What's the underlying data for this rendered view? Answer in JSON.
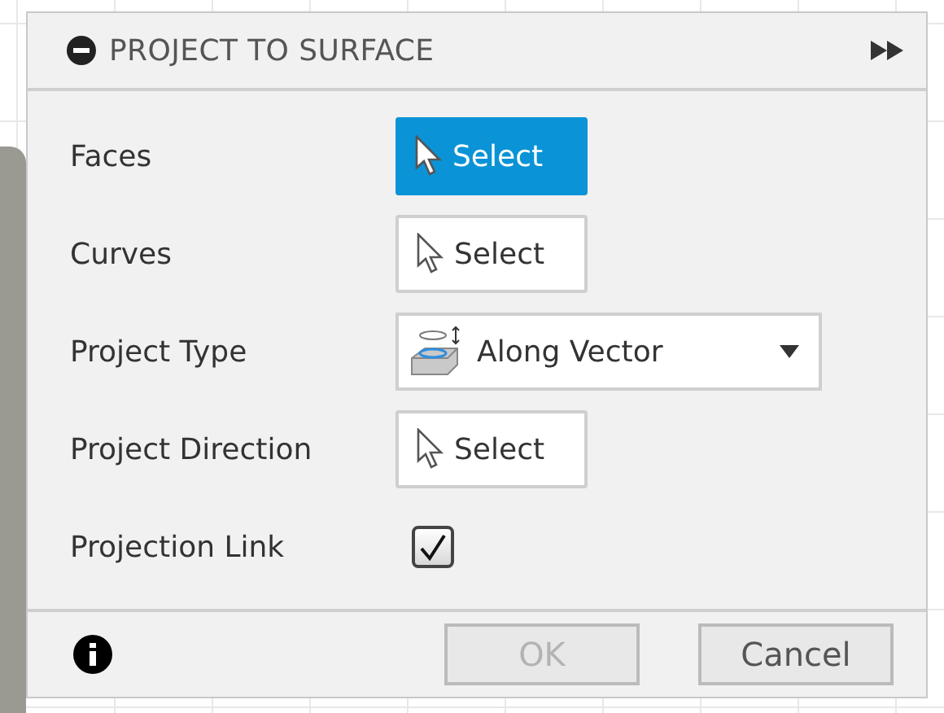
{
  "dialog": {
    "title": "PROJECT TO SURFACE"
  },
  "rows": [
    {
      "label": "Faces",
      "kind": "select",
      "value": "Select",
      "selected": true
    },
    {
      "label": "Curves",
      "kind": "select",
      "value": "Select",
      "selected": false
    },
    {
      "label": "Project Type",
      "kind": "dropdown",
      "value": "Along Vector"
    },
    {
      "label": "Project Direction",
      "kind": "select",
      "value": "Select",
      "selected": false
    },
    {
      "label": "Projection Link",
      "kind": "checkbox",
      "checked": true
    }
  ],
  "buttons": [
    {
      "label": "OK",
      "disabled": true
    },
    {
      "label": "Cancel",
      "disabled": false
    }
  ]
}
